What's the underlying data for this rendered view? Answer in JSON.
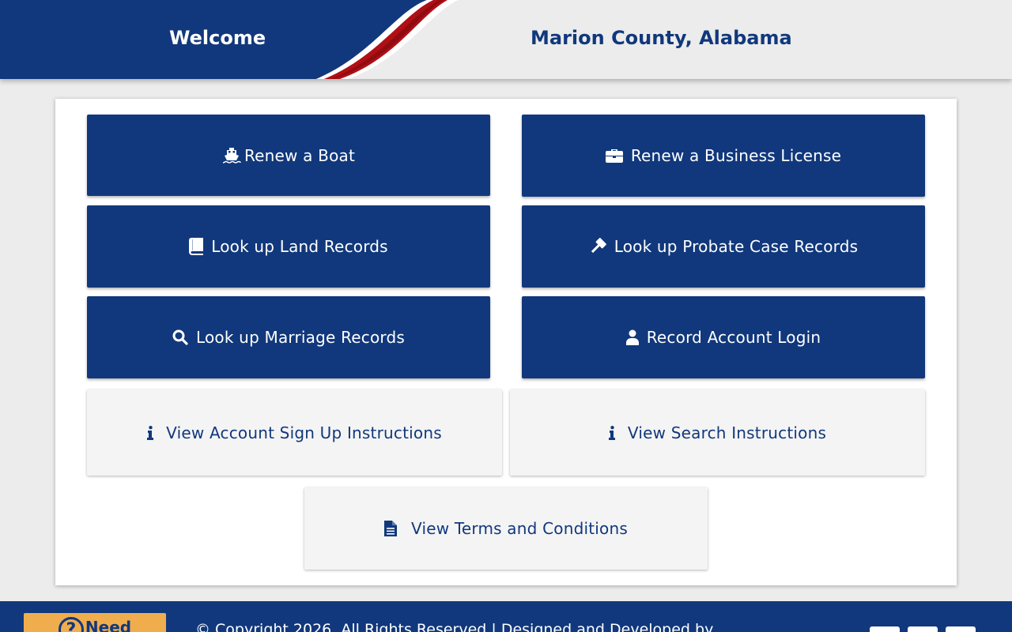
{
  "header": {
    "welcome": "Welcome",
    "county": "Marion County, Alabama"
  },
  "buttons": {
    "renew_boat": "Renew a Boat",
    "renew_business": "Renew a Business License",
    "land_records": "Look up Land Records",
    "probate_records": "Look up Probate Case Records",
    "marriage_records": "Look up Marriage Records",
    "account_login": "Record Account Login",
    "signup_instructions": "View Account Sign Up Instructions",
    "search_instructions": "View Search Instructions",
    "terms": "View Terms and Conditions"
  },
  "footer": {
    "help_label": "Need",
    "help_icon": "?",
    "copyright": "© Copyright 2026. All Rights Reserved  |  Designed and Developed by"
  },
  "colors": {
    "primary": "#11387c",
    "secondary_bg": "#f4f4f4",
    "accent_red": "#b00f15",
    "help_bg": "#f0ad4e"
  },
  "icons": {
    "renew_boat": "ship-icon",
    "renew_business": "briefcase-icon",
    "land_records": "book-icon",
    "probate_records": "gavel-icon",
    "marriage_records": "search-icon",
    "account_login": "user-icon",
    "signup_instructions": "info-icon",
    "search_instructions": "info-icon",
    "terms": "document-icon"
  }
}
